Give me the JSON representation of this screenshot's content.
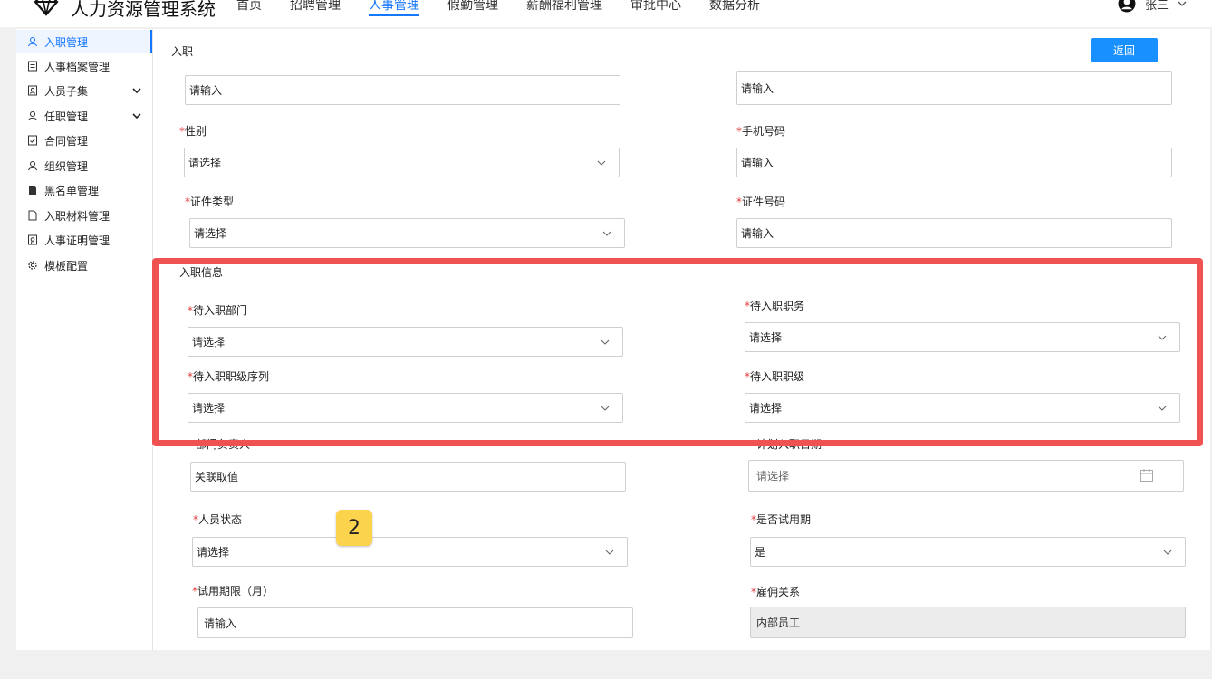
{
  "app": {
    "title": "人力资源管理系统",
    "nav": [
      "首页",
      "招聘管理",
      "人事管理",
      "假勤管理",
      "薪酬福利管理",
      "审批中心",
      "数据分析"
    ],
    "active_nav": "人事管理",
    "user": "张三"
  },
  "sidebar": {
    "items": [
      {
        "label": "入职管理",
        "icon": "user-icon"
      },
      {
        "label": "人事档案管理",
        "icon": "file-list-icon"
      },
      {
        "label": "人员子集",
        "icon": "person-card-icon"
      },
      {
        "label": "任职管理",
        "icon": "user-icon"
      },
      {
        "label": "合同管理",
        "icon": "contract-icon"
      },
      {
        "label": "组织管理",
        "icon": "user-icon"
      },
      {
        "label": "黑名单管理",
        "icon": "blacklist-file-icon"
      },
      {
        "label": "入职材料管理",
        "icon": "document-icon"
      },
      {
        "label": "人事证明管理",
        "icon": "certificate-icon"
      },
      {
        "label": "模板配置",
        "icon": "gear-icon"
      }
    ]
  },
  "main": {
    "title": "入职",
    "back_label": "返回",
    "top_left_value": "请输入",
    "top_right_value": "请输入",
    "gender": {
      "label": "性别",
      "value": "请选择"
    },
    "phone": {
      "label": "手机号码",
      "value": "请输入"
    },
    "id_type": {
      "label": "证件类型",
      "value": "请选择"
    },
    "id_number": {
      "label": "证件号码",
      "value": "请输入"
    },
    "section_title": "入职信息",
    "department": {
      "label": "待入职部门",
      "value": "请选择"
    },
    "position": {
      "label": "待入职职务",
      "value": "请选择"
    },
    "rank_seq": {
      "label": "待入职职级序列",
      "value": "请选择"
    },
    "rank": {
      "label": "待入职职级",
      "value": "请选择"
    },
    "dept_head": {
      "label": "部门负责人",
      "value": "关联取值"
    },
    "entry_date": {
      "label": "计划入职日期",
      "value": "请选择"
    },
    "status": {
      "label": "人员状态",
      "value": "请选择"
    },
    "probation": {
      "label": "是否试用期",
      "value": "是"
    },
    "probation_months": {
      "label": "试用期限（月）",
      "value": "请输入"
    },
    "employment": {
      "label": "雇佣关系",
      "value": "内部员工"
    }
  },
  "annotation": {
    "badge": "2",
    "highlight_color": "#f05252"
  },
  "colors": {
    "accent": "#1677ff",
    "button": "#1890ff",
    "required": "#e23b3b"
  }
}
